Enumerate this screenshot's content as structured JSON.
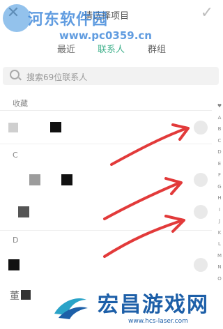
{
  "header": {
    "title": "请选择项目",
    "close_icon": "close-icon",
    "confirm_icon": "check-icon"
  },
  "tabs": [
    {
      "label": "最近"
    },
    {
      "label": "联系人",
      "active": true
    },
    {
      "label": "群组"
    }
  ],
  "search": {
    "placeholder": "搜索69位联系人"
  },
  "sections": [
    {
      "label": "收藏"
    },
    {
      "label": "C"
    },
    {
      "label": "D"
    }
  ],
  "contact_partial_labels": {
    "row5": "董"
  },
  "alphabet_index": [
    "♥",
    "A",
    "B",
    "C",
    "D",
    "E",
    "F",
    "G",
    "H",
    "I",
    "J",
    "K",
    "L",
    "M",
    "N",
    "O"
  ],
  "watermarks": {
    "top_text": "河东软件园",
    "top_url": "www.pc0359.cn",
    "bottom_text": "宏昌游戏网",
    "bottom_url": "www.hcs-laser.com"
  },
  "colors": {
    "accent": "#3fb08b",
    "arrow": "#e23a3a",
    "brand": "#1d5fa8",
    "watermark": "#2b7bd6"
  }
}
